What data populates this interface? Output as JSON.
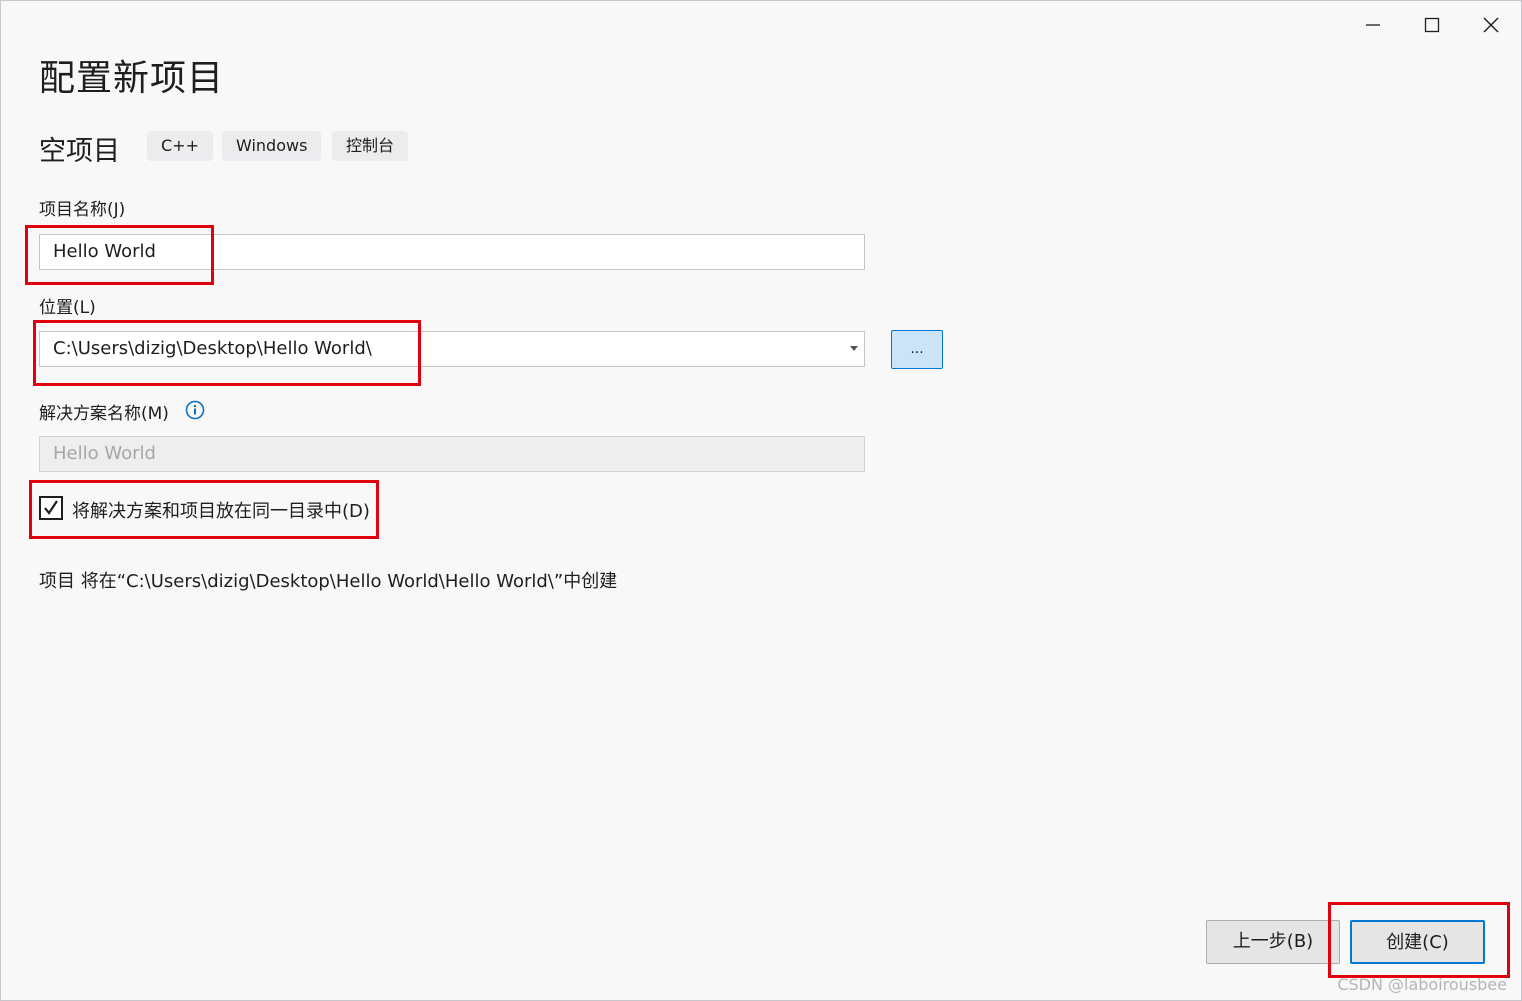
{
  "window": {
    "title": "配置新项目",
    "controls": [
      "minimize",
      "maximize",
      "close"
    ]
  },
  "template": {
    "name": "空项目",
    "tags": [
      "C++",
      "Windows",
      "控制台"
    ]
  },
  "project_name": {
    "label": "项目名称(J)",
    "value": "Hello World"
  },
  "location": {
    "label": "位置(L)",
    "value": "C:\\Users\\dizig\\Desktop\\Hello World\\",
    "browse_label": "..."
  },
  "solution_name": {
    "label": "解决方案名称(M)",
    "value": "Hello World",
    "info_icon": "info-icon"
  },
  "same_directory": {
    "label": "将解决方案和项目放在同一目录中(D)",
    "checked": true
  },
  "path_info": "项目 将在“C:\\Users\\dizig\\Desktop\\Hello World\\Hello World\\”中创建",
  "buttons": {
    "back": "上一步(B)",
    "create": "创建(C)"
  },
  "colors": {
    "accent": "#0078d4",
    "highlight": "#e0000f"
  },
  "watermark": "CSDN @laboirousbee"
}
